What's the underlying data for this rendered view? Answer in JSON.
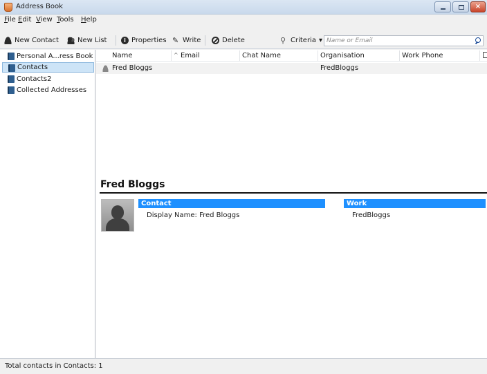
{
  "window": {
    "title": "Address Book"
  },
  "menubar": {
    "items": [
      {
        "accel": "F",
        "rest": "ile"
      },
      {
        "accel": "E",
        "rest": "dit"
      },
      {
        "accel": "V",
        "rest": "iew"
      },
      {
        "accel": "T",
        "rest": "ools"
      },
      {
        "accel": "H",
        "rest": "elp"
      }
    ]
  },
  "toolbar": {
    "new_contact": "New Contact",
    "new_list": "New List",
    "properties": "Properties",
    "write": "Write",
    "delete": "Delete",
    "criteria": "Criteria",
    "criteria_arrow": "▾",
    "search_placeholder": "Name or Email"
  },
  "sidebar": {
    "items": [
      {
        "label": "Personal A...ress Book",
        "selected": false
      },
      {
        "label": "Contacts",
        "selected": true
      },
      {
        "label": "Contacts2",
        "selected": false
      },
      {
        "label": "Collected Addresses",
        "selected": false
      }
    ]
  },
  "table": {
    "columns": [
      "Name",
      "Email",
      "Chat Name",
      "Organisation",
      "Work Phone"
    ],
    "sort_indicator": "^",
    "rows": [
      {
        "name": "Fred Bloggs",
        "email": "",
        "chat": "",
        "organisation": "FredBloggs",
        "work_phone": ""
      }
    ]
  },
  "details": {
    "name": "Fred Bloggs",
    "contact_header": "Contact",
    "display_name_line": "Display Name: Fred Bloggs",
    "work_header": "Work",
    "work_org": "FredBloggs"
  },
  "statusbar": {
    "text": "Total contacts in Contacts: 1"
  },
  "colors": {
    "accent": "#1e90ff",
    "selection": "#cde4f7"
  }
}
